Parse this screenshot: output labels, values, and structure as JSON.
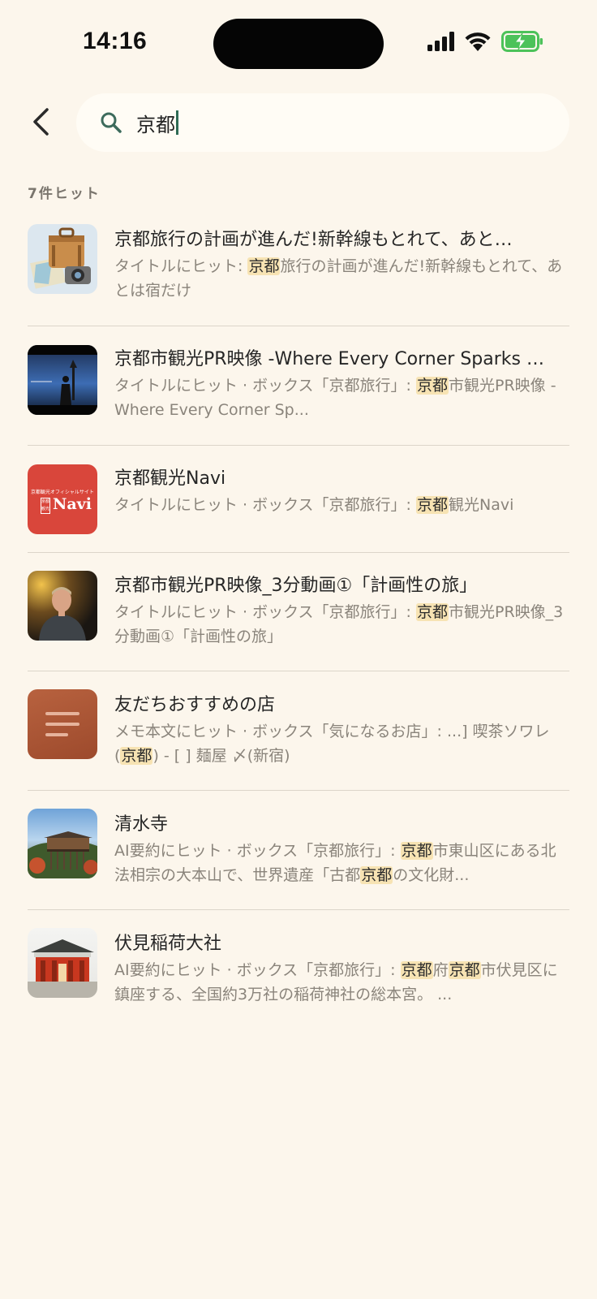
{
  "status_bar": {
    "time": "14:16"
  },
  "search": {
    "query": "京都"
  },
  "hit_count": "7件ヒット",
  "results": [
    {
      "title": "京都旅行の計画が進んだ!新幹線もとれて、あと…",
      "snippet": [
        {
          "t": "タイトルにヒット: "
        },
        {
          "t": "京都",
          "hl": true
        },
        {
          "t": "旅行の計画が進んだ!新幹線もとれて、あとは宿だけ"
        }
      ]
    },
    {
      "title": "京都市観光PR映像 -Where Every Corner Sparks …",
      "snippet": [
        {
          "t": "タイトルにヒット · ボックス「京都旅行」: "
        },
        {
          "t": "京都",
          "hl": true
        },
        {
          "t": "市観光PR映像 -Where Every Corner Sp..."
        }
      ]
    },
    {
      "title": "京都観光Navi",
      "thumb_text": "Navi",
      "thumb_small": "京都観光オフィシャルサイト",
      "thumb_side": "京都観光",
      "snippet": [
        {
          "t": "タイトルにヒット · ボックス「京都旅行」: "
        },
        {
          "t": "京都",
          "hl": true
        },
        {
          "t": "観光Navi"
        }
      ]
    },
    {
      "title": "京都市観光PR映像_3分動画①「計画性の旅」",
      "snippet": [
        {
          "t": "タイトルにヒット · ボックス「京都旅行」: "
        },
        {
          "t": "京都",
          "hl": true
        },
        {
          "t": "市観光PR映像_3分動画①「計画性の旅」"
        }
      ]
    },
    {
      "title": "友だちおすすめの店",
      "snippet": [
        {
          "t": "メモ本文にヒット · ボックス「気になるお店」: ...] 喫茶ソワレ("
        },
        {
          "t": "京都",
          "hl": true
        },
        {
          "t": ") - [ ] 麺屋 〆(新宿)"
        }
      ]
    },
    {
      "title": "清水寺",
      "snippet": [
        {
          "t": "AI要約にヒット · ボックス「京都旅行」: "
        },
        {
          "t": "京都",
          "hl": true
        },
        {
          "t": "市東山区にある北法相宗の大本山で、世界遺産「古都"
        },
        {
          "t": "京都",
          "hl": true
        },
        {
          "t": "の文化財..."
        }
      ]
    },
    {
      "title": "伏見稲荷大社",
      "snippet": [
        {
          "t": "AI要約にヒット · ボックス「京都旅行」: "
        },
        {
          "t": "京都",
          "hl": true
        },
        {
          "t": "府"
        },
        {
          "t": "京都",
          "hl": true
        },
        {
          "t": "市伏見区に鎮座する、全国約3万社の稲荷神社の総本宮。 ..."
        }
      ]
    }
  ]
}
